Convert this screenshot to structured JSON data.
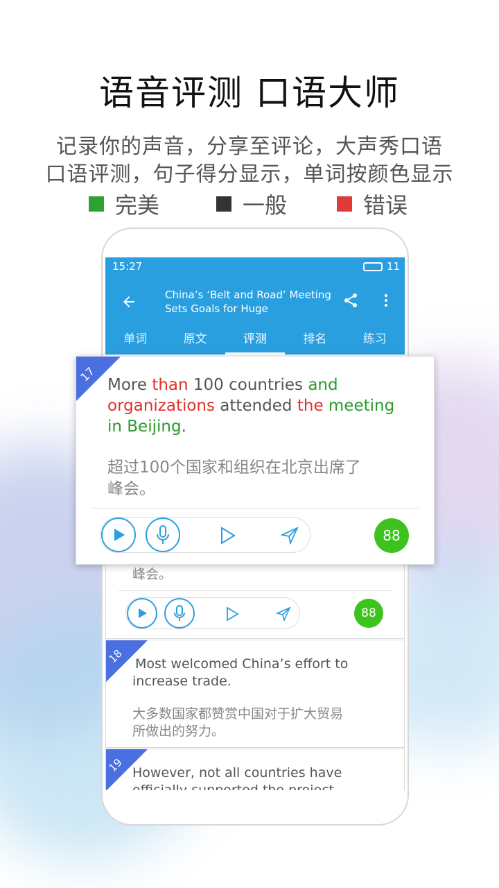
{
  "headline": "语音评测 口语大师",
  "subtitle_line1": "记录你的声音，分享至评论，大声秀口语",
  "subtitle_line2": "口语评测，句子得分显示，单词按颜色显示",
  "legend": [
    {
      "label": "完美",
      "color": "#2ea12e"
    },
    {
      "label": "一般",
      "color": "#333333"
    },
    {
      "label": "错误",
      "color": "#e03a3a"
    }
  ],
  "status": {
    "time": "15:27",
    "battery": "11"
  },
  "toolbar": {
    "title_line1": "China’s ‘Belt and Road’ Meeting",
    "title_line2": "Sets Goals for Huge",
    "back_icon": "arrow-left-icon",
    "share_icon": "share-icon",
    "more_icon": "more-vert-icon"
  },
  "tabs": [
    "单词",
    "原文",
    "评测",
    "排名",
    "练习"
  ],
  "active_tab": "评测",
  "cards": {
    "c17": {
      "number": "17",
      "sentence_words": [
        {
          "t": "More ",
          "s": "normal"
        },
        {
          "t": "than",
          "s": "wrong"
        },
        {
          "t": " 100 countries ",
          "s": "normal"
        },
        {
          "t": "and",
          "s": "perfect"
        },
        {
          "t": "organizations",
          "s": "wrong"
        },
        {
          "t": " attended ",
          "s": "normal"
        },
        {
          "t": "the",
          "s": "wrong"
        },
        {
          "t": " ",
          "s": "normal"
        },
        {
          "t": "meeting",
          "s": "perfect"
        },
        {
          "t": "in Beijing",
          "s": "perfect"
        },
        {
          "t": ".",
          "s": "normal"
        }
      ],
      "translation_line1": "超过100个国家和组织在北京出席了",
      "translation_line2": "峰会。",
      "score": "88"
    },
    "c17_behind": {
      "translation_tail": "峰会。",
      "score": "88"
    },
    "c18": {
      "number": "18",
      "sentence_line1": "Most welcomed China’s effort to",
      "sentence_line2": "increase trade.",
      "translation_line1": "大多数国家都赞赏中国对于扩大贸易",
      "translation_line2": "所做出的努力。"
    },
    "c19": {
      "number": "19",
      "sentence_line1": "However, not all countries have",
      "sentence_line2": "officially supported the project."
    }
  },
  "colors": {
    "appbar": "#2a9fdf",
    "perfect": "#2a9a2a",
    "normal": "#555555",
    "wrong": "#e0302b",
    "score": "#3ec31e",
    "ribbon": "#4a6fe0"
  }
}
